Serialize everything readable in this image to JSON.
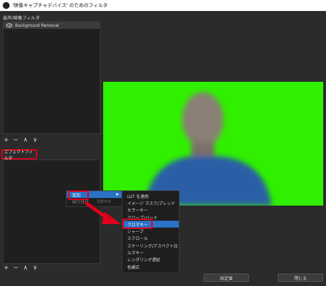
{
  "window": {
    "title": "'映像キャプチャデバイス' のためのフィルタ"
  },
  "audio_video_filters": {
    "label": "音声/映像フィルタ",
    "items": [
      {
        "label": "Background Removal"
      }
    ]
  },
  "effect_filters": {
    "label": "エフェクトフィルタ"
  },
  "toolbar": {
    "add": "+",
    "remove": "−",
    "up": "∧",
    "down": "∨"
  },
  "context_menu": {
    "items": [
      {
        "label": "追加",
        "shortcut": ""
      },
      {
        "label": "貼り付け",
        "shortcut": "Ctrl+V"
      }
    ]
  },
  "submenu": {
    "items": [
      "LUT を適用",
      "イメージ マスク/ブレンド",
      "カラーキー",
      "クロップ/パッド",
      "クロマキー",
      "シャープ",
      "スクロール",
      "スケーリング/アスペクト比",
      "ルマキー",
      "レンダリング遅延",
      "色補正"
    ],
    "selected_index": 4
  },
  "buttons": {
    "defaults": "既定値",
    "close": "閉じる"
  },
  "colors": {
    "green_screen": "#30f000",
    "highlight": "#e0001b",
    "menu_active": "#2a72c6"
  }
}
